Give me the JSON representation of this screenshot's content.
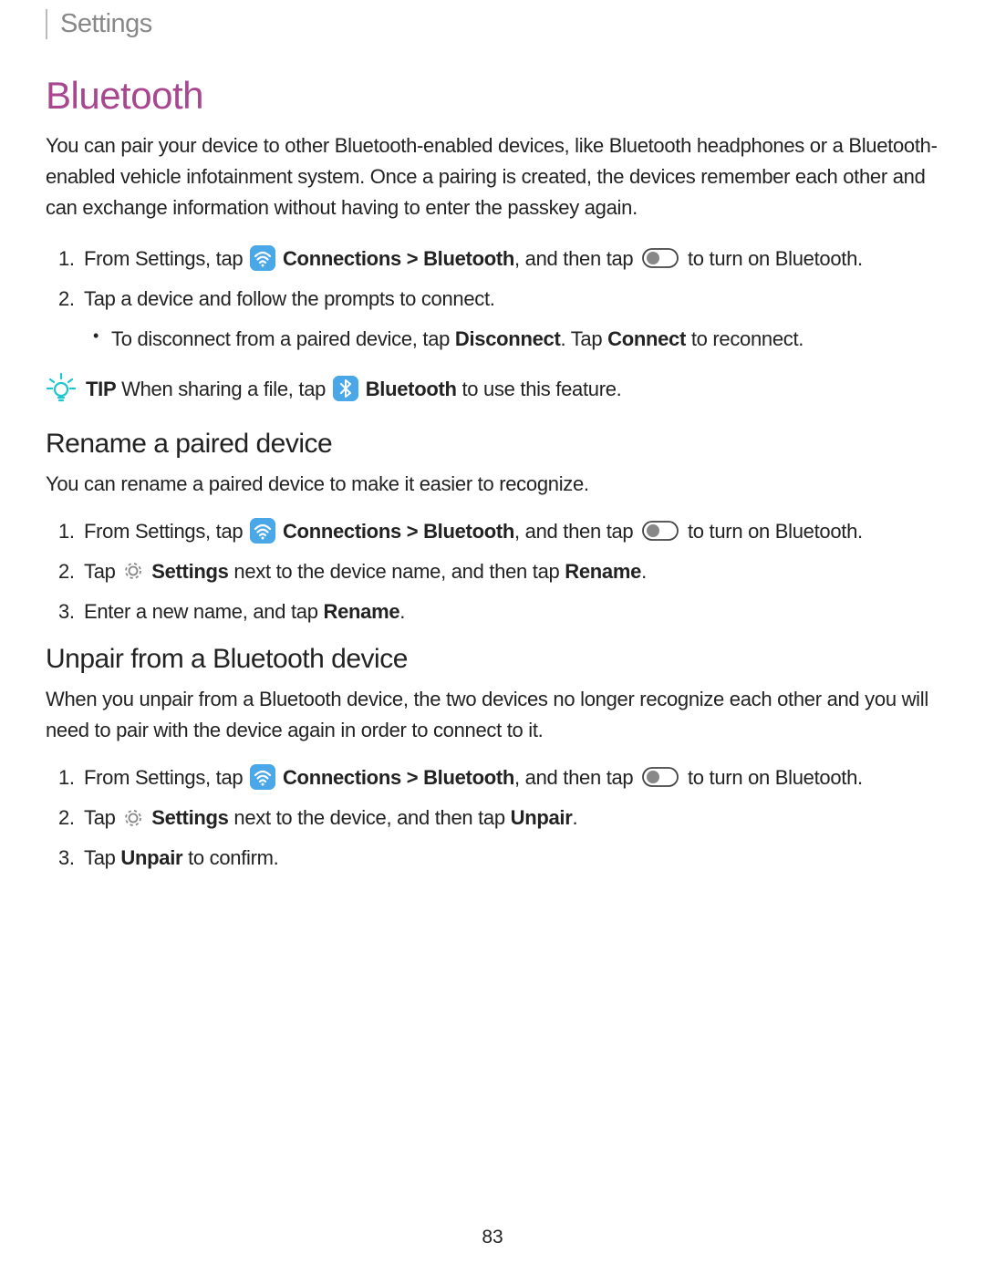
{
  "header": {
    "breadcrumb": "Settings"
  },
  "main": {
    "title": "Bluetooth",
    "intro": "You can pair your device to other Bluetooth-enabled devices, like Bluetooth headphones or a Bluetooth-enabled vehicle infotainment system. Once a pairing is created, the devices remember each other and can exchange information without having to enter the passkey again."
  },
  "steps": {
    "s1_pre": "From Settings, tap ",
    "s1_conn": "Connections > Bluetooth",
    "s1_mid": ", and then tap ",
    "s1_end": " to turn on Bluetooth.",
    "s2": "Tap a device and follow the prompts to connect.",
    "s2_sub_pre": "To disconnect from a paired device, tap ",
    "s2_sub_disc": "Disconnect",
    "s2_sub_mid": ". Tap ",
    "s2_sub_conn": "Connect",
    "s2_sub_end": " to reconnect."
  },
  "tip": {
    "label": "TIP",
    "pre": " When sharing a file, tap ",
    "bt": "Bluetooth",
    "end": " to use this feature."
  },
  "rename": {
    "title": "Rename a paired device",
    "intro": "You can rename a paired device to make it easier to recognize.",
    "s1_pre": "From Settings, tap ",
    "s1_conn": "Connections > Bluetooth",
    "s1_mid": ", and then tap ",
    "s1_end": " to turn on Bluetooth.",
    "s2_pre": "Tap ",
    "s2_settings": "Settings",
    "s2_mid": " next to the device name, and then tap ",
    "s2_rename": "Rename",
    "s2_end": ".",
    "s3_pre": "Enter a new name, and tap ",
    "s3_rename": "Rename",
    "s3_end": "."
  },
  "unpair": {
    "title": "Unpair from a Bluetooth device",
    "intro": "When you unpair from a Bluetooth device, the two devices no longer recognize each other and you will need to pair with the device again in order to connect to it.",
    "s1_pre": "From Settings, tap ",
    "s1_conn": "Connections > Bluetooth",
    "s1_mid": ", and then tap ",
    "s1_end": " to turn on Bluetooth.",
    "s2_pre": "Tap ",
    "s2_settings": "Settings",
    "s2_mid": " next to the device, and then tap ",
    "s2_unpair": "Unpair",
    "s2_end": ".",
    "s3_pre": "Tap ",
    "s3_unpair": "Unpair",
    "s3_end": " to confirm."
  },
  "page_number": "83"
}
